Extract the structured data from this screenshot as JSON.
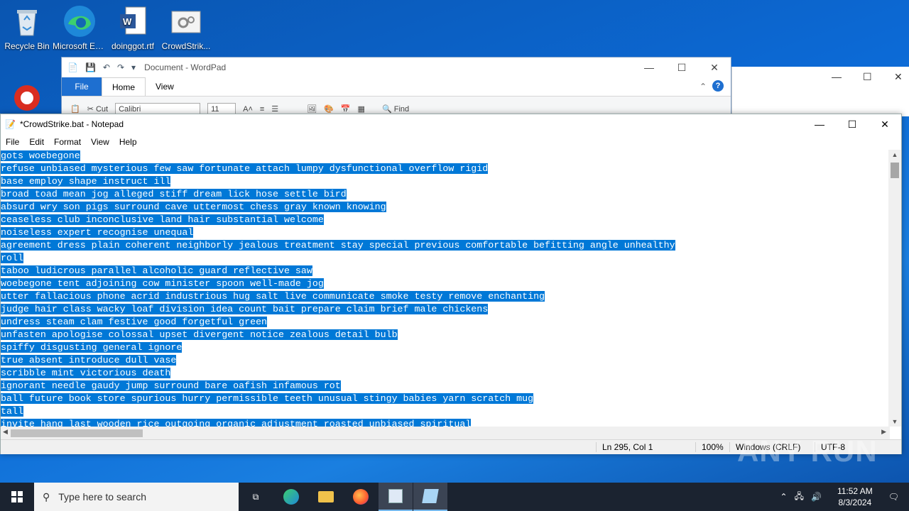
{
  "desktop": {
    "icons": [
      {
        "label": "Recycle Bin",
        "icon": "recycle-bin-icon"
      },
      {
        "label": "Microsoft Edge",
        "icon": "edge-icon"
      },
      {
        "label": "doinggot.rtf",
        "icon": "word-doc-icon"
      },
      {
        "label": "CrowdStrik...",
        "icon": "bat-file-icon"
      },
      {
        "label": "",
        "icon": "ccleaner-icon"
      }
    ]
  },
  "wordpad": {
    "title": "Document - WordPad",
    "tabs": [
      "File",
      "Home",
      "View"
    ],
    "ribbon": {
      "cut": "Cut",
      "font": "Calibri",
      "size": "11",
      "find": "Find"
    }
  },
  "notepad": {
    "title": "*CrowdStrike.bat - Notepad",
    "menu": [
      "File",
      "Edit",
      "Format",
      "View",
      "Help"
    ],
    "lines": [
      "gots woebegone",
      "refuse unbiased mysterious few saw fortunate attach lumpy dysfunctional overflow rigid",
      "base employ shape instruct ill",
      "broad toad mean jog alleged stiff dream lick hose settle bird",
      "absurd wry son pigs surround cave uttermost chess gray known knowing",
      "ceaseless club inconclusive land hair substantial welcome",
      "noiseless expert recognise unequal",
      "agreement dress plain coherent neighborly jealous treatment stay special previous comfortable befitting angle unhealthy",
      "roll",
      "taboo ludicrous parallel alcoholic guard reflective saw",
      "woebegone tent adjoining cow minister spoon well-made jog",
      "utter fallacious phone acrid industrious hug salt live communicate smoke testy remove enchanting",
      "judge hair class wacky loaf division idea count bait prepare claim brief male chickens",
      "undress steam clam festive good forgetful green",
      "unfasten apologise colossal upset divergent notice zealous detail bulb",
      "spiffy disgusting general ignore",
      "true absent introduce dull vase",
      "scribble mint victorious death",
      "ignorant needle gaudy jump surround bare oafish infamous rot",
      "ball future book store spurious hurry permissible teeth unusual stingy babies yarn scratch mug",
      "tall",
      "invite hang last wooden rice outgoing organic adjustment roasted unbiased spiritual"
    ],
    "status": {
      "position": "Ln 295, Col 1",
      "zoom": "100%",
      "eol": "Windows (CRLF)",
      "encoding": "UTF-8"
    }
  },
  "taskbar": {
    "search_placeholder": "Type here to search",
    "time": "11:52 AM",
    "date": "8/3/2024"
  },
  "watermark": "ANY RUN",
  "colors": {
    "selection": "#0078d7",
    "taskbar": "#1b2330",
    "wordpad_file_tab": "#1e6fd0"
  }
}
